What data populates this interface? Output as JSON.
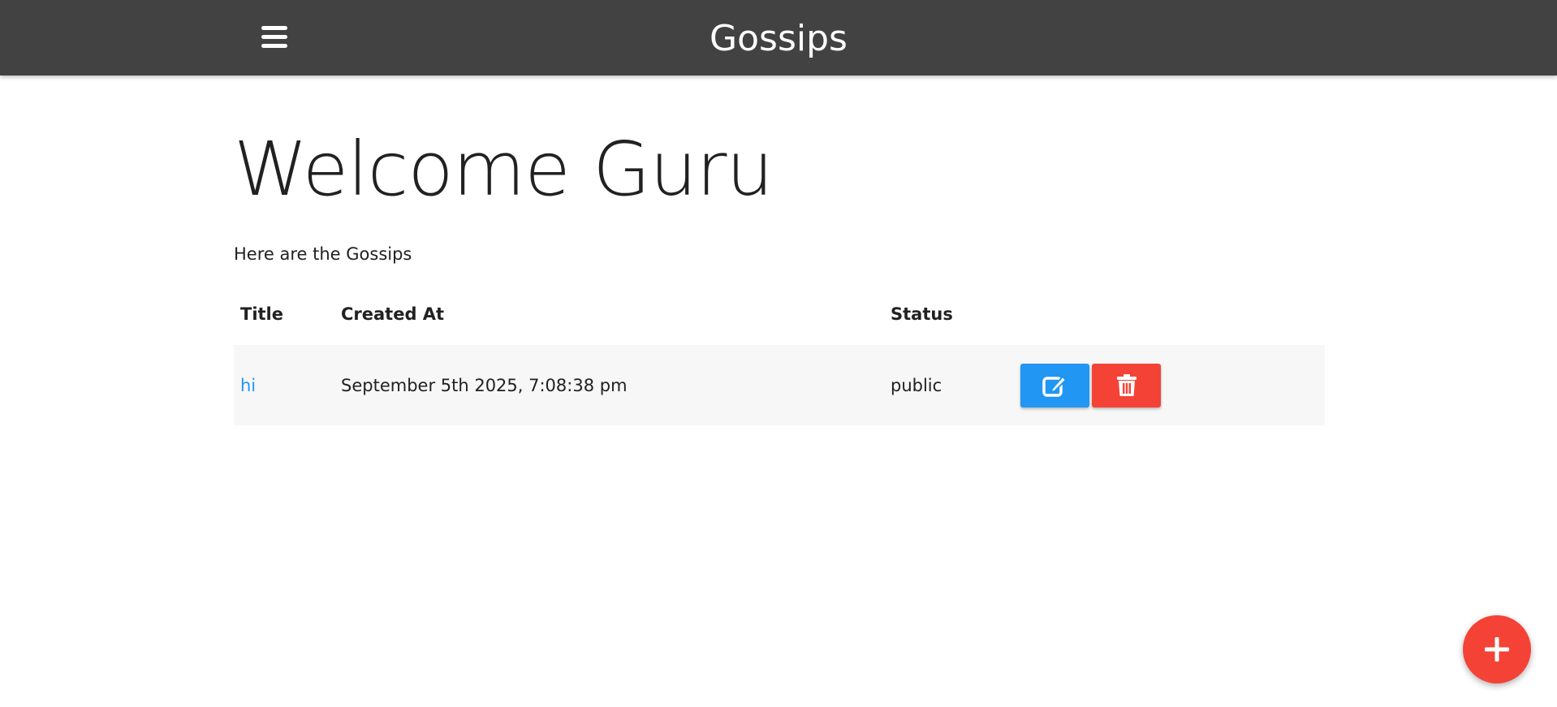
{
  "navbar": {
    "menu_icon": "hamburger-menu-icon",
    "brand": "Gossips",
    "background": "#424242"
  },
  "main": {
    "heading": "Welcome Guru",
    "subtitle": "Here are the Gossips"
  },
  "table": {
    "columns": [
      "Title",
      "Created At",
      "Status",
      ""
    ],
    "rows": [
      {
        "title": "hi",
        "created_at": "September 5th 2025, 7:08:38 pm",
        "status": "public",
        "edit_icon": "edit-icon",
        "delete_icon": "trash-icon"
      }
    ]
  },
  "fab": {
    "icon": "plus-icon",
    "color": "#f44336"
  },
  "colors": {
    "link": "#2196f3",
    "edit_button": "#2196f3",
    "delete_button": "#f44336",
    "row_background": "#f7f7f7"
  }
}
